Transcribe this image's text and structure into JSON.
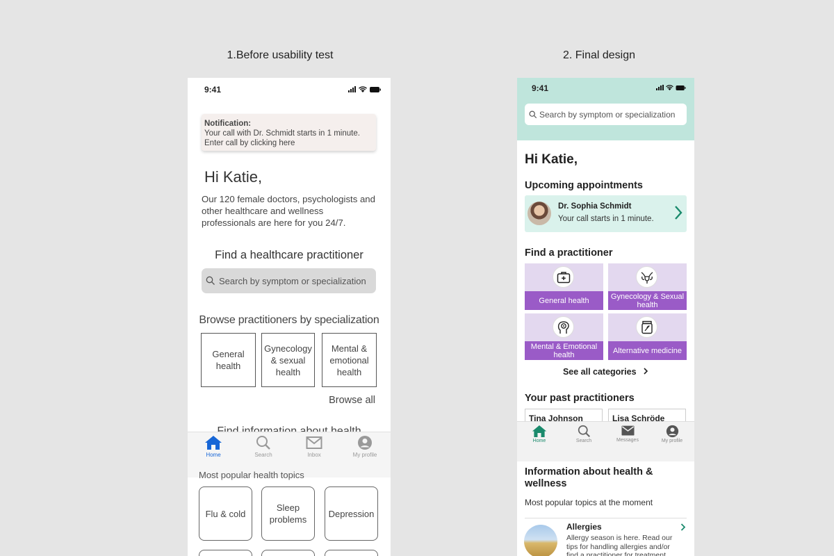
{
  "captions": {
    "before": "1.Before usability test",
    "final": "2. Final design"
  },
  "before": {
    "status_time": "9:41",
    "notification": {
      "label": "Notification:",
      "line1": "Your call with Dr. Schmidt starts in 1 minute.",
      "line2": "Enter call by clicking here"
    },
    "greeting": "Hi Katie,",
    "intro": "Our 120 female doctors, psychologists and other healthcare and wellness professionals are here for you 24/7.",
    "find_title": "Find a healthcare practitioner",
    "search_placeholder": "Search by symptom or specialization",
    "browse_title": "Browse practitioners by specialization",
    "specializations": [
      "General health",
      "Gynecology & sexual health",
      "Mental & emotional health"
    ],
    "browse_all": "Browse all",
    "find_info_title": "Find information about health",
    "tabs": [
      "Home",
      "Search",
      "Inbox",
      "My profile"
    ],
    "popular_title": "Most popular health topics",
    "topics": [
      "Flu & cold",
      "Sleep problems",
      "Depression"
    ],
    "colors": {
      "active_tab": "#1766d6"
    }
  },
  "final": {
    "status_time": "9:41",
    "search_placeholder": "Search by symptom or specialization",
    "greeting": "Hi Katie,",
    "upcoming_title": "Upcoming appointments",
    "appointment": {
      "name": "Dr. Sophia Schmidt",
      "detail": "Your call starts in 1 minute."
    },
    "find_title": "Find a practitioner",
    "categories": [
      {
        "label": "General health",
        "icon": "first-aid-kit-icon"
      },
      {
        "label": "Gynecology & Sexual health",
        "icon": "uterus-icon"
      },
      {
        "label": "Mental & Emotional health",
        "icon": "brain-head-icon"
      },
      {
        "label": "Alternative medicine",
        "icon": "herbal-jar-icon"
      }
    ],
    "see_all": "See all categories",
    "past_title": "Your past practitioners",
    "past_practitioners": [
      "Tina Johnson",
      "Lisa Schröde"
    ],
    "tabs": [
      "Home",
      "Search",
      "Messages",
      "My profile"
    ],
    "info_title": "Information about health & wellness",
    "info_subtitle": "Most popular topics at the moment",
    "article": {
      "title": "Allergies",
      "text": "Allergy season is here. Read our tips for handling allergies and/or find a practitioner for treatment."
    },
    "colors": {
      "header": "#bfe5dc",
      "accent": "#1a8a6c",
      "category_label": "#9a5bc7",
      "category_bg": "#e3d8ef"
    }
  }
}
